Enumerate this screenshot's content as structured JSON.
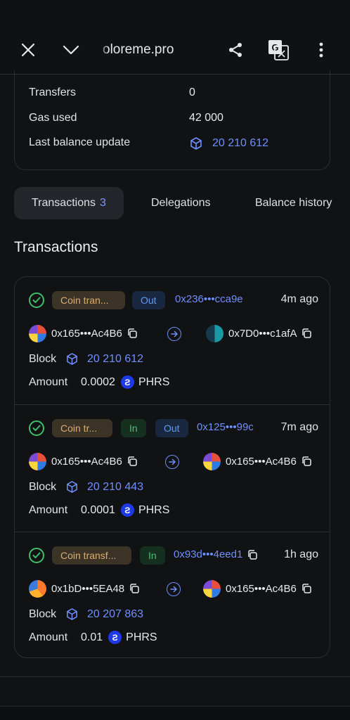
{
  "browser": {
    "url": "oloreme.pro"
  },
  "address_info": {
    "rows": [
      {
        "label": "Transfers",
        "value": "0"
      },
      {
        "label": "Gas used",
        "value": "42 000"
      },
      {
        "label": "Last balance update",
        "value": "20 210 612"
      }
    ]
  },
  "tabs": [
    {
      "label": "Transactions",
      "count": "3"
    },
    {
      "label": "Delegations"
    },
    {
      "label": "Balance history"
    }
  ],
  "section_title": "Transactions",
  "transactions": [
    {
      "type": "Coin tran...",
      "direction_badges": [
        "Out"
      ],
      "hash": "0x236•••cca9e",
      "time": "4m ago",
      "from": "0x165•••Ac4B6",
      "to": "0x7D0•••c1afA",
      "block_label": "Block",
      "block": "20 210 612",
      "amount_label": "Amount",
      "amount": "0.0002",
      "token": "PHRS"
    },
    {
      "type": "Coin tr...",
      "direction_badges": [
        "In",
        "Out"
      ],
      "hash": "0x125•••99c",
      "time": "7m ago",
      "from": "0x165•••Ac4B6",
      "to": "0x165•••Ac4B6",
      "block_label": "Block",
      "block": "20 210 443",
      "amount_label": "Amount",
      "amount": "0.0001",
      "token": "PHRS"
    },
    {
      "type": "Coin transf...",
      "direction_badges": [
        "In"
      ],
      "hash": "0x93d•••4eed1",
      "time": "1h ago",
      "from": "0x1bD•••5EA48",
      "to": "0x165•••Ac4B6",
      "block_label": "Block",
      "block": "20 207 863",
      "amount_label": "Amount",
      "amount": "0.01",
      "token": "PHRS"
    }
  ],
  "colors": {
    "background": "#111214",
    "link": "#6e8fff",
    "success": "#3fbf6c",
    "badge_type_bg": "#3c3327",
    "badge_out_bg": "#1a2740",
    "badge_in_bg": "#163020"
  },
  "icons": {
    "close": "close-icon",
    "collapse": "chevron-down-icon",
    "share": "share-icon",
    "translate": "translate-icon",
    "menu": "more-vertical-icon",
    "block": "cube-icon",
    "status": "check-circle-icon",
    "copy": "copy-icon",
    "arrow": "arrow-right-icon",
    "token": "pharos-token-icon"
  }
}
